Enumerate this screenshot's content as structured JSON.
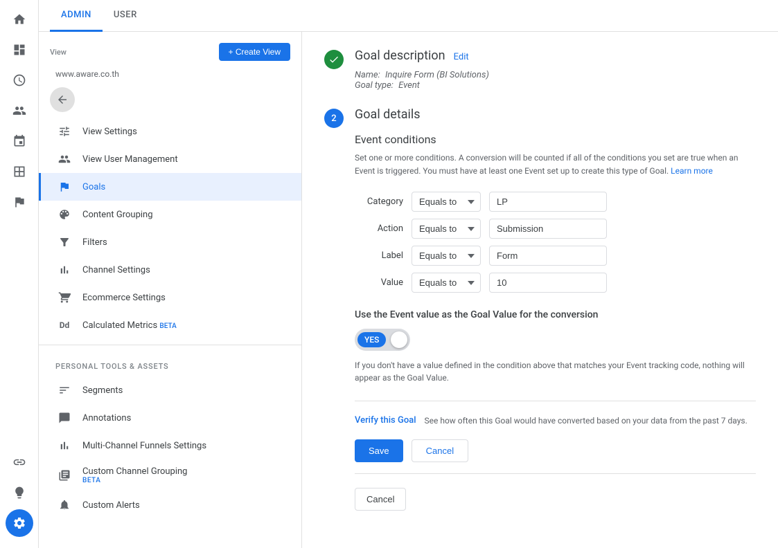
{
  "tabs": {
    "admin": "ADMIN",
    "user": "USER"
  },
  "view": {
    "label": "View",
    "create_btn": "+ Create View",
    "domain": "www.aware.co.th"
  },
  "nav": {
    "items": [
      {
        "id": "view-settings",
        "label": "View Settings",
        "icon": "settings"
      },
      {
        "id": "view-user-management",
        "label": "View User Management",
        "icon": "people"
      },
      {
        "id": "goals",
        "label": "Goals",
        "icon": "flag",
        "active": true
      },
      {
        "id": "content-grouping",
        "label": "Content Grouping",
        "icon": "palette"
      },
      {
        "id": "filters",
        "label": "Filters",
        "icon": "filter"
      },
      {
        "id": "channel-settings",
        "label": "Channel Settings",
        "icon": "bar-chart"
      },
      {
        "id": "ecommerce-settings",
        "label": "Ecommerce Settings",
        "icon": "cart"
      },
      {
        "id": "calculated-metrics",
        "label": "Calculated Metrics",
        "icon": "Dd",
        "beta": "BETA"
      }
    ],
    "personal_section": "PERSONAL TOOLS & ASSETS",
    "personal_items": [
      {
        "id": "segments",
        "label": "Segments",
        "icon": "segments"
      },
      {
        "id": "annotations",
        "label": "Annotations",
        "icon": "annotations"
      },
      {
        "id": "multi-channel",
        "label": "Multi-Channel Funnels Settings",
        "icon": "multi"
      },
      {
        "id": "custom-channel",
        "label": "Custom Channel Grouping",
        "icon": "custom-channel",
        "beta": "BETA"
      },
      {
        "id": "custom-alerts",
        "label": "Custom Alerts",
        "icon": "alerts"
      }
    ]
  },
  "goal_description": {
    "title": "Goal description",
    "edit_link": "Edit",
    "name_label": "Name:",
    "name_value": "Inquire Form (BI Solutions)",
    "type_label": "Goal type:",
    "type_value": "Event"
  },
  "goal_details": {
    "title": "Goal details",
    "event_conditions_title": "Event conditions",
    "event_conditions_desc": "Set one or more conditions. A conversion will be counted if all of the conditions you set are true when an Event is triggered. You must have at least one Event set up to create this type of Goal.",
    "learn_more": "Learn more",
    "conditions": [
      {
        "label": "Category",
        "operator": "Equals to",
        "value": "LP"
      },
      {
        "label": "Action",
        "operator": "Equals to",
        "value": "Submission"
      },
      {
        "label": "Label",
        "operator": "Equals to",
        "value": "Form"
      },
      {
        "label": "Value",
        "operator": "Equals to",
        "value": "10"
      }
    ],
    "toggle_title": "Use the Event value as the Goal Value for the conversion",
    "toggle_state": "YES",
    "toggle_desc": "If you don't have a value defined in the condition above that matches your Event tracking code, nothing will appear as the Goal Value.",
    "verify_link": "Verify this Goal",
    "verify_desc": "See how often this Goal would have converted based on your data from the past 7 days.",
    "save_btn": "Save",
    "cancel_btn": "Cancel",
    "bottom_cancel_btn": "Cancel"
  },
  "sidebar_icons": {
    "home": "⌂",
    "dashboard": "▦",
    "reports": "◷",
    "user": "👤",
    "realtime": "✦",
    "conversions": "◈",
    "flag": "⚑",
    "gear": "⚙"
  }
}
